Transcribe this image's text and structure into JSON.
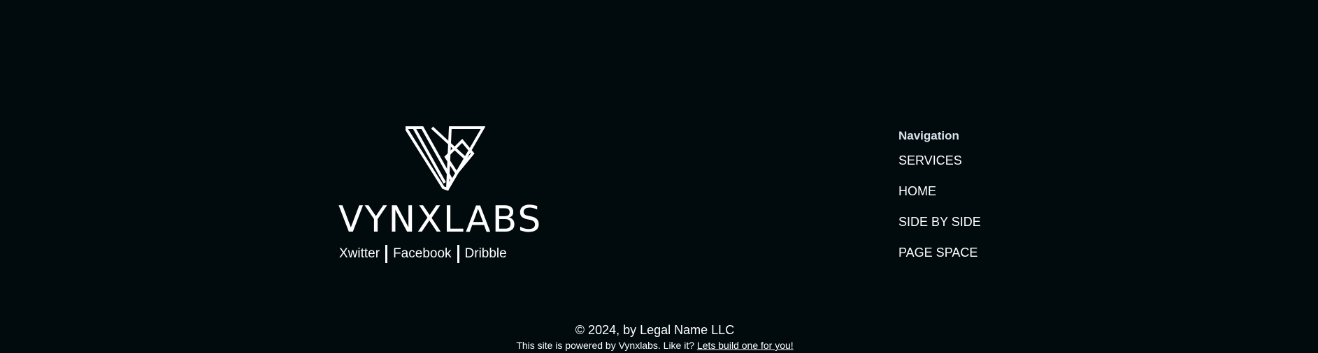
{
  "brand": {
    "wordmark": "VYNXLABS",
    "logo_icon": "vynxlabs-logo-mark"
  },
  "social": {
    "links": [
      {
        "label": "Xwitter"
      },
      {
        "label": "Facebook"
      },
      {
        "label": "Dribble"
      }
    ]
  },
  "navigation": {
    "heading": "Navigation",
    "links": [
      {
        "label": "SERVICES"
      },
      {
        "label": "HOME"
      },
      {
        "label": "SIDE BY SIDE"
      },
      {
        "label": "PAGE SPACE"
      }
    ]
  },
  "footer": {
    "copyright": "© 2024, by Legal Name LLC",
    "powered_text": "This site is powered by Vynxlabs. Like it? ",
    "build_link": "Lets build one for you!"
  },
  "colors": {
    "background": "#010a0d",
    "text": "#ffffff",
    "heading": "#d8e3ea"
  }
}
